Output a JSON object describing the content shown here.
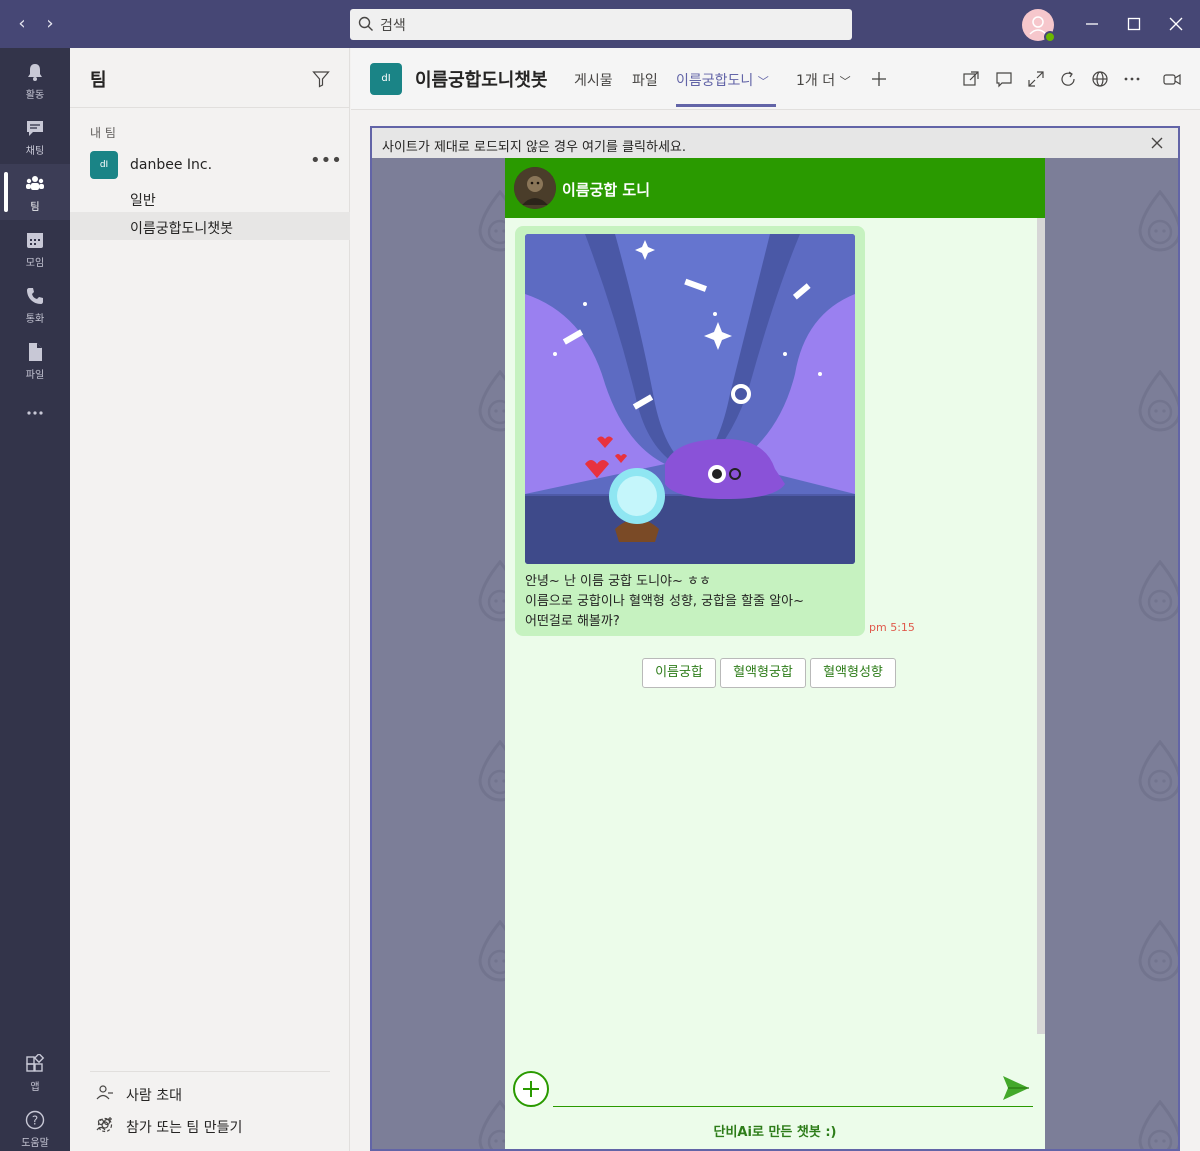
{
  "titlebar": {
    "search_placeholder": "검색"
  },
  "rail": [
    {
      "label": "활동",
      "icon": "bell-icon"
    },
    {
      "label": "채팅",
      "icon": "chat-icon"
    },
    {
      "label": "팀",
      "icon": "teams-icon"
    },
    {
      "label": "모임",
      "icon": "calendar-icon"
    },
    {
      "label": "통화",
      "icon": "phone-icon"
    },
    {
      "label": "파일",
      "icon": "file-icon"
    }
  ],
  "rail_bottom": [
    {
      "label": "앱",
      "icon": "apps-icon"
    },
    {
      "label": "도움말",
      "icon": "help-icon"
    }
  ],
  "panel": {
    "title": "팀",
    "section": "내 팀",
    "team": {
      "avatar": "dI",
      "name": "danbee Inc."
    },
    "channels": [
      "일반",
      "이름궁합도니챗봇"
    ],
    "footer": {
      "invite": "사람 초대",
      "join": "참가 또는 팀 만들기"
    }
  },
  "header": {
    "avatar": "dI",
    "title": "이름궁합도니챗봇",
    "tabs": {
      "posts": "게시물",
      "files": "파일",
      "bot": "이름궁합도니",
      "more": "1개 더"
    }
  },
  "notice": "사이트가 제대로 로드되지 않은 경우 여기를 클릭하세요.",
  "chat": {
    "bot_name": "이름궁합 도니",
    "message": {
      "lines": [
        "안녕~ 난 이름 궁합 도니야~ ㅎㅎ",
        "이름으로 궁합이나 혈액형 성향, 궁합을 할줄 알아~",
        "어떤걸로 해볼까?"
      ],
      "time": "pm 5:15"
    },
    "quick_replies": [
      "이름궁합",
      "혈액형궁합",
      "혈액형성향"
    ],
    "credit_brand": "단비Ai",
    "credit_rest": "로 만든 챗봇 :)"
  },
  "colors": {
    "titlebar": "#464775",
    "rail": "#33344a",
    "accent": "#6264a7",
    "bot_green": "#2a9a00",
    "chat_bg": "#ecfcea",
    "bubble": "#c6f2c0"
  }
}
